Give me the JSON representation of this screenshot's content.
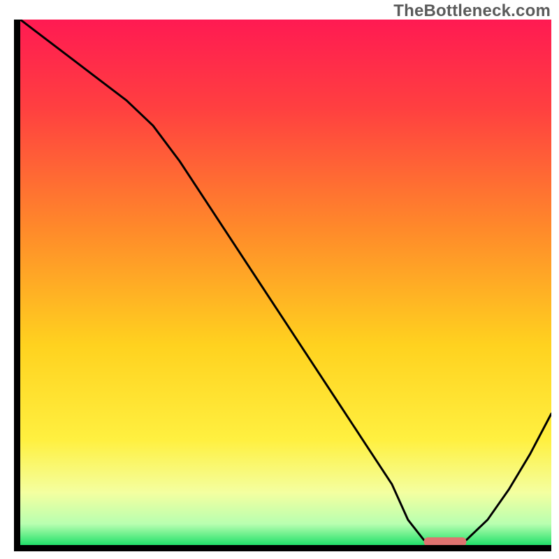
{
  "watermark": {
    "text": "TheBottleneck.com"
  },
  "chart_data": {
    "type": "line",
    "title": "",
    "xlabel": "",
    "ylabel": "",
    "xlim": [
      0,
      100
    ],
    "ylim": [
      0,
      104
    ],
    "grid": false,
    "legend": false,
    "note": "No axis tick labels are shown in the image. x and y units are arbitrary (0–100). y ≈ bottleneck %, curve dips to ~0 near x≈80 where the marker sits, rising on both sides.",
    "series": [
      {
        "name": "bottleneck-curve",
        "x": [
          0,
          5,
          10,
          15,
          20,
          25,
          30,
          35,
          40,
          45,
          50,
          55,
          60,
          65,
          70,
          73,
          76,
          80,
          84,
          88,
          92,
          96,
          100
        ],
        "y": [
          104,
          100,
          96,
          92,
          88,
          83,
          76,
          68,
          60,
          52,
          44,
          36,
          28,
          20,
          12,
          5,
          1,
          0,
          1,
          5,
          11,
          18,
          26
        ]
      }
    ],
    "marker": {
      "name": "optimal-range",
      "x_start": 76,
      "x_end": 84,
      "y": 0,
      "shape": "rounded-bar",
      "color": "#df7370"
    },
    "background_gradient": {
      "stops": [
        {
          "offset": 0.0,
          "color": "#ff1a52"
        },
        {
          "offset": 0.17,
          "color": "#ff4040"
        },
        {
          "offset": 0.4,
          "color": "#ff8a2a"
        },
        {
          "offset": 0.62,
          "color": "#ffd21f"
        },
        {
          "offset": 0.8,
          "color": "#fff040"
        },
        {
          "offset": 0.9,
          "color": "#f4ffa0"
        },
        {
          "offset": 0.96,
          "color": "#b8ffb0"
        },
        {
          "offset": 1.0,
          "color": "#22e06a"
        }
      ]
    }
  }
}
